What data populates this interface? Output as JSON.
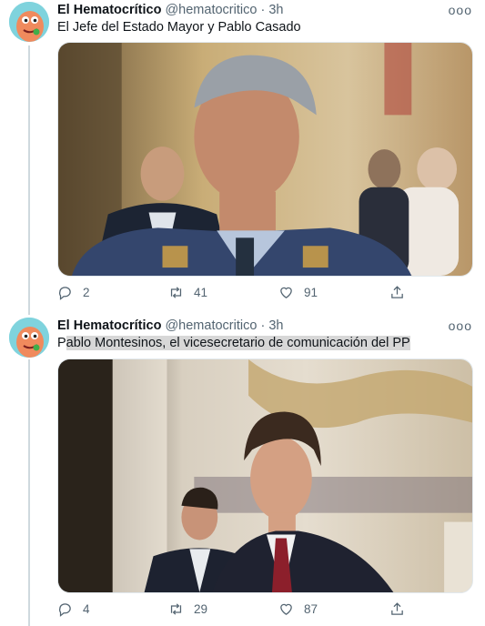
{
  "tweets": [
    {
      "author": "El Hematocrítico",
      "handle": "@hematocritico",
      "separator": "·",
      "time": "3h",
      "text": "El Jefe del Estado Mayor y Pablo Casado",
      "text_highlight": "",
      "replies": "2",
      "retweets": "41",
      "likes": "91"
    },
    {
      "author": "El Hematocrítico",
      "handle": "@hematocritico",
      "separator": "·",
      "time": "3h",
      "text": "P",
      "text_highlight": "ablo Montesinos, el vicesecretario de comunicación del PP",
      "replies": "4",
      "retweets": "29",
      "likes": "87"
    }
  ],
  "more_label": "ooo",
  "icons": [
    "avatar",
    "reply-icon",
    "retweet-icon",
    "like-icon",
    "share-icon",
    "more-icon"
  ],
  "colors": {
    "avatar_bg": "#7fd3dd",
    "secondary_text": "#536471",
    "thread_line": "#cfd9de",
    "highlight": "#d7d7d7"
  }
}
